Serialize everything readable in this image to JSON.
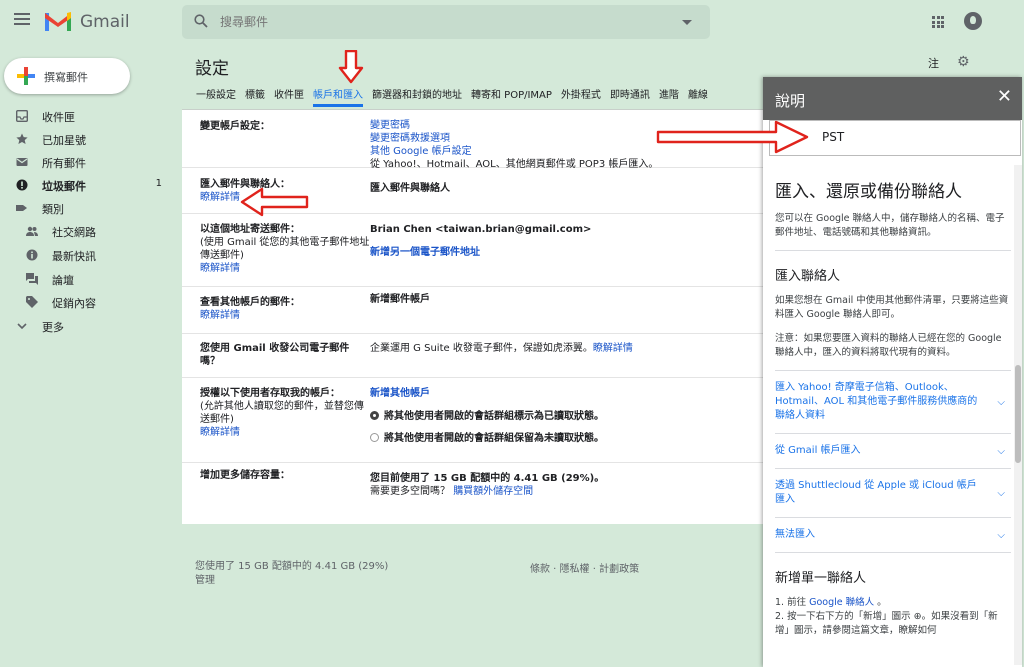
{
  "app": {
    "name": "Gmail"
  },
  "search": {
    "placeholder": "搜尋郵件"
  },
  "compose": {
    "label": "撰寫郵件"
  },
  "sidebar": {
    "items": [
      {
        "label": "收件匣",
        "count": ""
      },
      {
        "label": "已加星號",
        "count": ""
      },
      {
        "label": "所有郵件",
        "count": ""
      },
      {
        "label": "垃圾郵件",
        "count": "1"
      },
      {
        "label": "類別",
        "count": ""
      },
      {
        "label": "社交網路",
        "count": ""
      },
      {
        "label": "最新快訊",
        "count": ""
      },
      {
        "label": "論壇",
        "count": ""
      },
      {
        "label": "促銷內容",
        "count": ""
      },
      {
        "label": "更多",
        "count": ""
      }
    ]
  },
  "settings": {
    "title": "設定",
    "lang": "注",
    "tabs": [
      "一般設定",
      "標籤",
      "收件匣",
      "帳戶和匯入",
      "篩選器和封鎖的地址",
      "轉寄和 POP/IMAP",
      "外掛程式",
      "即時通訊",
      "進階",
      "離線"
    ],
    "rows": {
      "change": {
        "label": "變更帳戶設定：",
        "links": [
          "變更密碼",
          "變更密碼救援選項",
          "其他 Google 帳戶設定"
        ],
        "note": "從 Yahoo!、Hotmail、AOL、其他網頁郵件或 POP3 帳戶匯入。"
      },
      "import": {
        "label": "匯入郵件與聯絡人：",
        "learn": "瞭解詳情",
        "action": "匯入郵件與聯絡人"
      },
      "sendas": {
        "label": "以這個地址寄送郵件：",
        "sub": "(使用 Gmail 從您的其他電子郵件地址傳送郵件)",
        "learn": "瞭解詳情",
        "address": "Brian Chen <taiwan.brian@gmail.com>",
        "action": "新增另一個電子郵件地址"
      },
      "check": {
        "label": "查看其他帳戶的郵件：",
        "learn": "瞭解詳情",
        "action": "新增郵件帳戶"
      },
      "work": {
        "label": "您使用 Gmail 收發公司電子郵件嗎？",
        "text": "企業運用 G Suite 收發電子郵件，保證如虎添翼。",
        "learn": "瞭解詳情"
      },
      "grant": {
        "label": "授權以下使用者存取我的帳戶：",
        "sub": "(允許其他人讀取您的郵件，並替您傳送郵件)",
        "learn": "瞭解詳情",
        "action": "新增其他帳戶",
        "opt1": "將其他使用者開啟的會話群組標示為已讀取狀態。",
        "opt2": "將其他使用者開啟的會話群組保留為未讀取狀態。"
      },
      "storage": {
        "label": "增加更多儲存容量：",
        "usage": "您目前使用了 15 GB 配額中的 4.41 GB (29%)。",
        "need": "需要更多空間嗎？",
        "buy": "購買額外儲存空間"
      }
    }
  },
  "footer": {
    "usage": "您使用了 15 GB 配額中的 4.41 GB (29%)",
    "manage": "管理",
    "links": "條款 · 隱私權 · 計劃政策"
  },
  "help": {
    "title": "說明",
    "close": "✕",
    "search_value": "PST",
    "h1": "匯入、還原或備份聯絡人",
    "intro": "您可以在 Google 聯絡人中，儲存聯絡人的名稱、電子郵件地址、電話號碼和其他聯絡資訊。",
    "h2a": "匯入聯絡人",
    "p1": "如果您想在 Gmail 中使用其他郵件清單，只要將這些資料匯入 Google 聯絡人即可。",
    "p2": "注意：如果您要匯入資料的聯絡人已經在您的 Google 聯絡人中，匯入的資料將取代現有的資料。",
    "accordions": [
      "匯入 Yahoo! 奇摩電子信箱、Outlook、Hotmail、AOL 和其他電子郵件服務供應商的聯絡人資料",
      "從 Gmail 帳戶匯入",
      "透過 Shuttlecloud 從 Apple 或 iCloud 帳戶匯入",
      "無法匯入"
    ],
    "h2b": "新增單一聯絡人",
    "step1_pre": "1. 前往 ",
    "step1_link": "Google 聯絡人",
    "step1_post": " 。",
    "step2": "2. 按一下右下方的「新增」圖示 ⊕。如果沒看到「新增」圖示，請參閱這篇文章，瞭解如何"
  },
  "colors": {
    "accent": "#1a73e8",
    "background": "#d4e9d9",
    "arrow": "#e0231c"
  }
}
